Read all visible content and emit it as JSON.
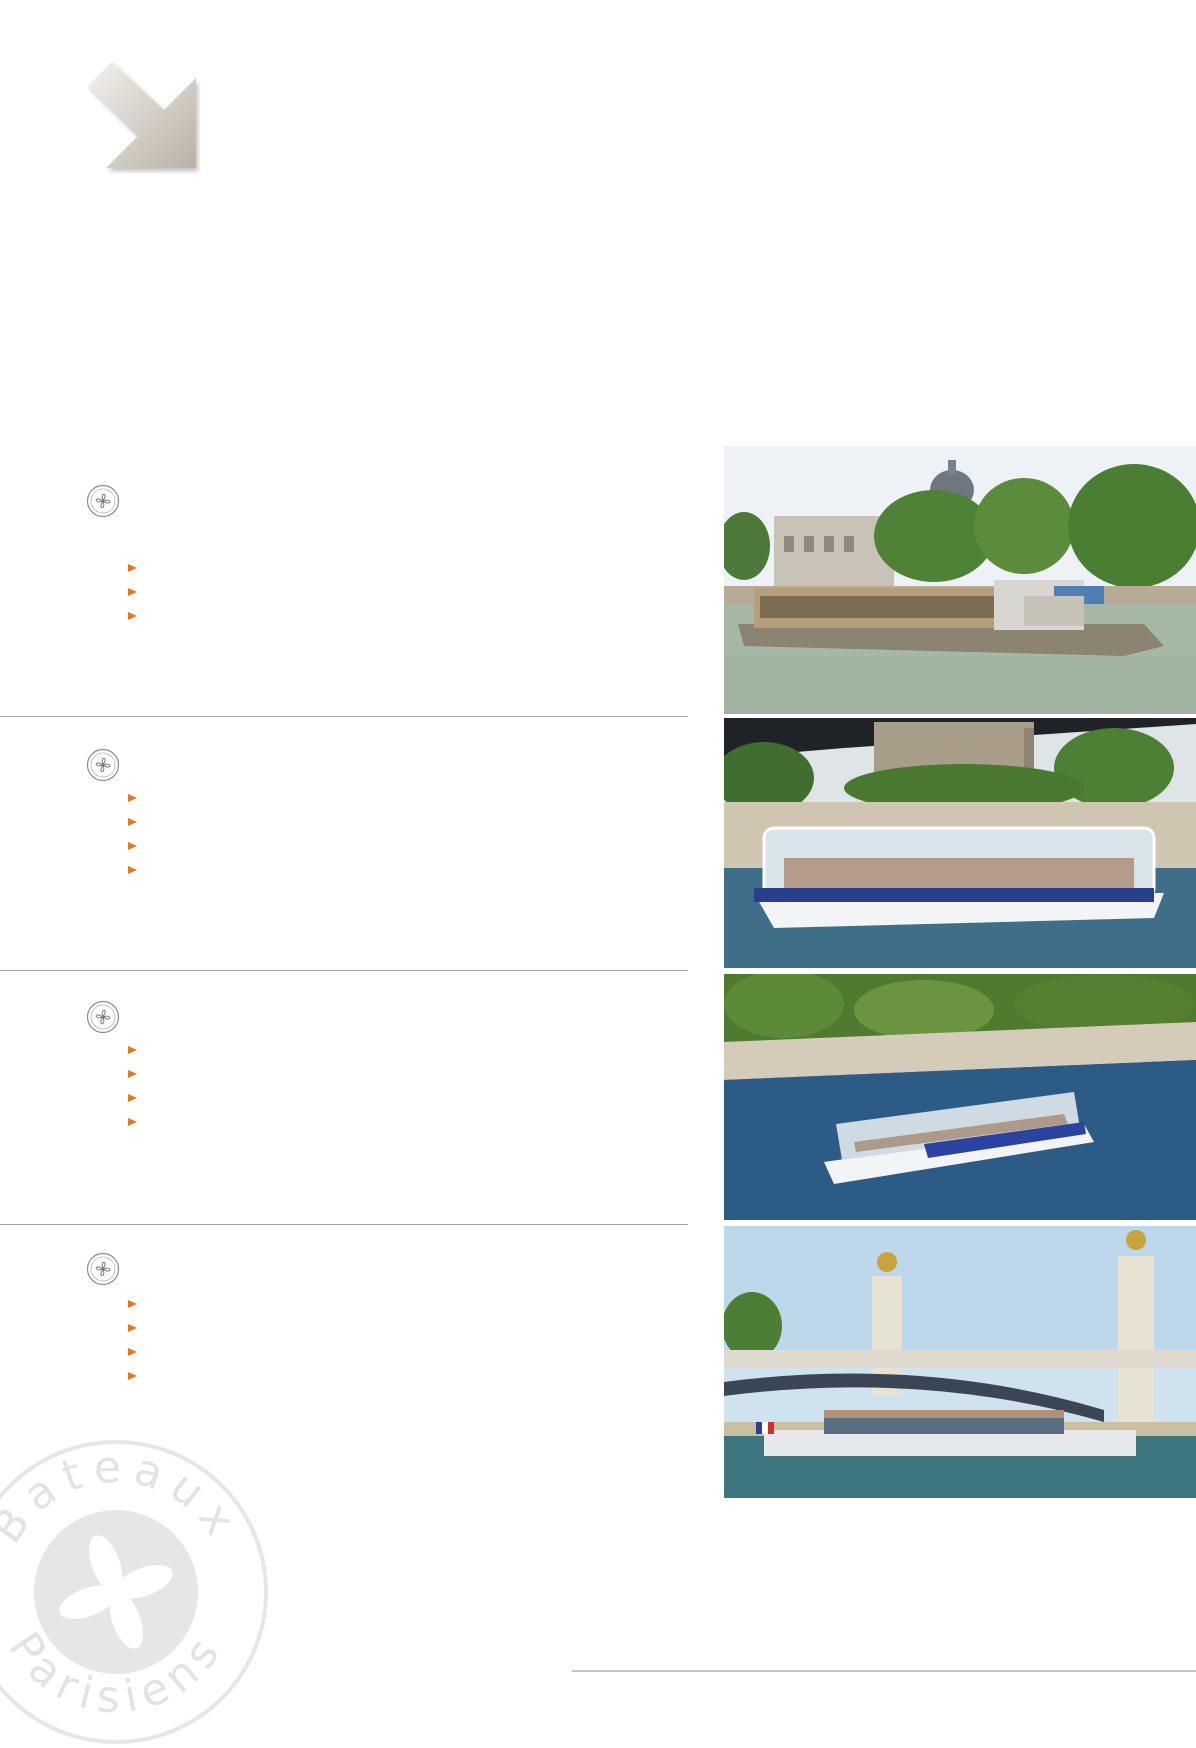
{
  "document": {
    "header_icon": "diagonal-arrow-icon",
    "sections": [
      {
        "icon": "rosette-icon",
        "bullet_count": 3,
        "photo": "boat-near-institut-de-france"
      },
      {
        "icon": "rosette-icon",
        "bullet_count": 4,
        "photo": "glass-roof-boat-near-notre-dame"
      },
      {
        "icon": "rosette-icon",
        "bullet_count": 4,
        "photo": "glass-roof-boat-on-seine"
      },
      {
        "icon": "rosette-icon",
        "bullet_count": 4,
        "photo": "boat-under-pont-alexandre-iii"
      }
    ],
    "watermark": {
      "text_top": "Bateaux",
      "text_bottom": "Parisiens"
    }
  },
  "colors": {
    "bullet": "#e07a1f",
    "divider": "#a6a6a6",
    "watermark": "#e6e6e6",
    "arrow": "#cfc9c0"
  }
}
